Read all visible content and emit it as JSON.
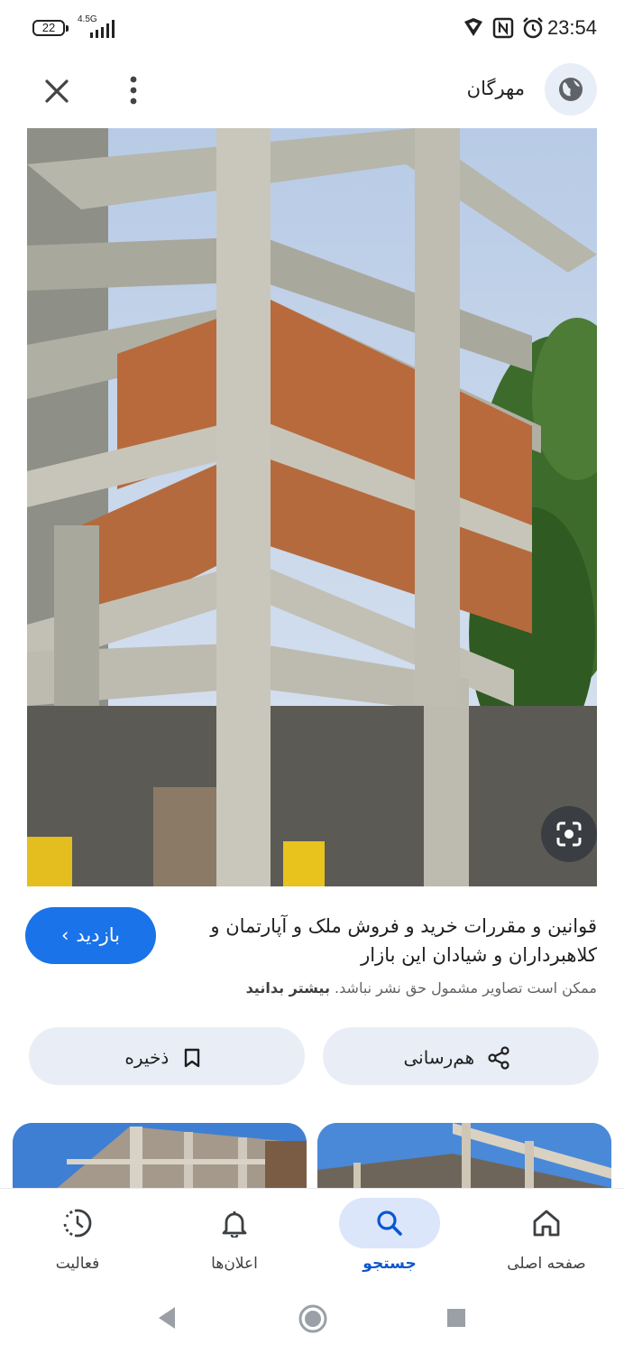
{
  "status_bar": {
    "battery": "22",
    "network": "4.5G",
    "time": "23:54"
  },
  "top_bar": {
    "site_name": "مهرگان"
  },
  "result": {
    "visit_label": "بازدید",
    "title": "قوانین و مقررات خرید و فروش ملک و آپارتمان و کلاهبرداران و شیادان این بازار",
    "notice_text": "ممکن است تصاویر مشمول حق نشر نباشد.",
    "notice_link": "بیشتر بدانید"
  },
  "actions": {
    "share_label": "هم‌رسانی",
    "save_label": "ذخیره"
  },
  "bottom_nav": {
    "items": [
      {
        "label": "صفحه اصلی",
        "icon": "home-icon"
      },
      {
        "label": "جستجو",
        "icon": "search-icon",
        "active": true
      },
      {
        "label": "اعلان‌ها",
        "icon": "bell-icon"
      },
      {
        "label": "فعالیت",
        "icon": "activity-icon"
      }
    ]
  },
  "colors": {
    "accent": "#1a73e8",
    "active_label": "#0b57d0",
    "pill_bg": "#e9eef6",
    "active_pill": "#dbe6fb"
  }
}
